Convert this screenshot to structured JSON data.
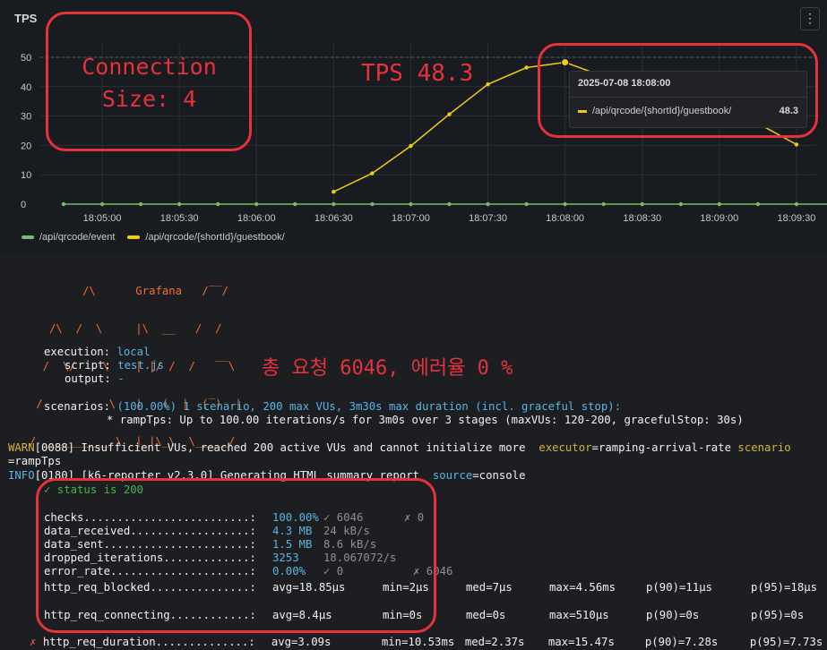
{
  "panel": {
    "title": "TPS",
    "menu_icon": "kebab-icon"
  },
  "chart_data": {
    "type": "line",
    "title": "TPS",
    "ylim": [
      0,
      50
    ],
    "yticks": [
      "0",
      "10",
      "20",
      "30",
      "40",
      "50"
    ],
    "xticks": [
      "18:05:00",
      "18:05:30",
      "18:06:00",
      "18:06:30",
      "18:07:00",
      "18:07:30",
      "18:08:00",
      "18:08:30",
      "18:09:00",
      "18:09:30"
    ],
    "series": [
      {
        "name": "/api/qrcode/event",
        "color": "#73bf69",
        "points": [
          [
            0,
            0
          ],
          [
            0.5,
            0
          ],
          [
            1,
            0
          ],
          [
            1.5,
            0
          ],
          [
            2,
            0
          ],
          [
            2.5,
            0
          ],
          [
            3,
            0
          ],
          [
            3.5,
            0
          ],
          [
            4,
            0
          ],
          [
            4.5,
            0
          ],
          [
            5,
            0
          ],
          [
            5.5,
            0
          ],
          [
            6,
            0
          ],
          [
            6.5,
            0
          ],
          [
            7,
            0
          ],
          [
            7.5,
            0
          ],
          [
            8,
            0
          ],
          [
            8.5,
            0
          ],
          [
            9,
            0
          ],
          [
            9.5,
            0
          ],
          [
            10,
            0
          ]
        ]
      },
      {
        "name": "/api/qrcode/{shortId}/guestbook/",
        "color": "#f2cc0c",
        "points": [
          [
            3.5,
            4.2
          ],
          [
            4,
            10.5
          ],
          [
            4.5,
            19.8
          ],
          [
            5,
            30.6
          ],
          [
            5.5,
            40.8
          ],
          [
            6,
            46.5
          ],
          [
            6.5,
            48.3
          ],
          [
            7,
            43.5
          ],
          [
            7.5,
            37.5
          ],
          [
            8,
            32.5
          ],
          [
            8.5,
            27
          ],
          [
            9,
            27.5
          ],
          [
            9.5,
            20.3
          ]
        ]
      }
    ],
    "highlight": {
      "x": 6.5,
      "y": 48.3
    }
  },
  "legend": [
    {
      "label": "/api/qrcode/event",
      "color": "#73bf69"
    },
    {
      "label": "/api/qrcode/{shortId}/guestbook/",
      "color": "#f2cc0c"
    }
  ],
  "tooltip": {
    "time": "2025-07-08 18:08:00",
    "series": "/api/qrcode/{shortId}/guestbook/",
    "value": "48.3"
  },
  "annotations": {
    "connection_1": "Connection",
    "connection_2": "Size: 4",
    "tps": "TPS 48.3",
    "total": "총 요청 6046, 에러율 0 %"
  },
  "terminal": {
    "logo_text": "Grafana",
    "logo_art": [
      "          /\\      Grafana   /‾‾/",
      "     /\\  /  \\     |\\  __   /  /",
      "    /  \\/    \\    | |/ /  /   ‾‾\\",
      "   /          \\   |   (  |  (‾)  |",
      "  / __________ \\  |_|\\_\\  \\_____/"
    ],
    "execution_key": "execution:",
    "execution_val": "local",
    "script_key": "script:",
    "script_val": "test.js",
    "output_key": "output:",
    "output_val": "-",
    "scenarios_key": "scenarios:",
    "scenarios_val": "(100.00%) 1 scenario, 200 max VUs, 3m30s max duration (incl. graceful stop):",
    "ramp_line": "* rampTps: Up to 100.00 iterations/s for 3m0s over 3 stages (maxVUs: 120-200, gracefulStop: 30s)",
    "warn_prefix": "WARN",
    "warn_text": "[0088] Insufficient VUs, reached 200 active VUs and cannot initialize more",
    "warn_kv_key": "executor",
    "warn_kv_val": "ramping-arrival-rate",
    "warn_kv2_key": "scenario",
    "warn_cont": "=rampTps",
    "info_prefix": "INFO",
    "info_text": "[0180] [k6-reporter v2.3.0] Generating HTML summary report",
    "info_kv_key": "source",
    "info_kv_val": "console",
    "status_check": "✓ status is 200",
    "metrics": [
      {
        "label": "checks.........................:",
        "value": "100.00%",
        "extra": "✓ 6046",
        "extra2": "✗ 0"
      },
      {
        "label": "data_received..................:",
        "value": "4.3 MB",
        "extra": "24 kB/s",
        "extra2": ""
      },
      {
        "label": "data_sent......................:",
        "value": "1.5 MB",
        "extra": "8.6 kB/s",
        "extra2": ""
      },
      {
        "label": "dropped_iterations.............:",
        "value": "3253",
        "extra": "18.067072/s",
        "extra2": ""
      },
      {
        "label": "error_rate.....................:",
        "value": "0.00%",
        "extra": "✓ 0",
        "extra2": "✗ 6046"
      }
    ],
    "http_blocked": {
      "label": "http_req_blocked...............:",
      "avg": "avg=18.85µs",
      "min": "min=2µs",
      "med": "med=7µs",
      "max": "max=4.56ms",
      "p90": "p(90)=11µs",
      "p95": "p(95)=18µs"
    },
    "http_connecting": {
      "label": "http_req_connecting............:",
      "avg": "avg=8.4µs",
      "min": "min=0s",
      "med": "med=0s",
      "max": "max=510µs",
      "p90": "p(90)=0s",
      "p95": "p(95)=0s"
    },
    "http_duration": {
      "mark": "✗",
      "label": "http_req_duration..............:",
      "avg": "avg=3.09s",
      "min": "min=10.53ms",
      "med": "med=2.37s",
      "max": "max=15.47s",
      "p90": "p(90)=7.28s",
      "p95": "p(95)=7.73s"
    }
  }
}
